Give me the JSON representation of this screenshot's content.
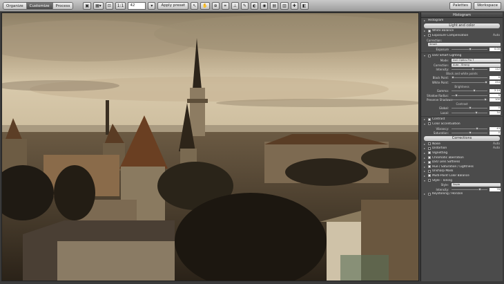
{
  "toolbar": {
    "modes": [
      "Organize",
      "Customize",
      "Process"
    ],
    "active_mode": "Customize",
    "zoom_ratio": "1:1",
    "zoom_value": "42",
    "apply_preset": "Apply preset",
    "palettes": "Palettes",
    "workspace": "Workspace"
  },
  "panel": {
    "title": "Histogram",
    "histogram_label": "Histogram",
    "light_color": "Light and color",
    "white_balance": "White Balance",
    "exposure_comp": "Exposure Compensation",
    "auto": "Auto",
    "correction_label": "Correction:",
    "correction_value": "Smart",
    "exposure_label": "Exposure",
    "exposure_value": "0.00",
    "smart_lighting": "DxO Smart Lighting",
    "mode_label": "Mode:",
    "mode_value": "DxO Optics Pro 7",
    "correction2_label": "Correction:",
    "correction2_value": "Auto - Strong",
    "intensity_label": "Intensity:",
    "intensity_value": "112",
    "black_white": "Black and white points",
    "black_point_label": "Black Point:",
    "black_point_value": "0",
    "white_point_label": "White Point:",
    "white_point_value": "254",
    "brightness": "Brightness",
    "gamma_label": "Gamma:",
    "gamma_value": "2.14",
    "shadow_radius_label": "Shadow Radius:",
    "shadow_radius_value": "9",
    "preserve_shadows_label": "Preserve Shadows:",
    "preserve_shadows_value": "100",
    "contrast": "Contrast",
    "global_label": "Global:",
    "global_value": "0",
    "local_label": "Local:",
    "local_value": "34",
    "contrast_row": "Contrast",
    "color_accent": "Color accentuation",
    "vibrancy_label": "Vibrancy:",
    "vibrancy_value": "43",
    "saturation_label": "Saturation:",
    "saturation_value": "0",
    "corrections": "Corrections",
    "noise": "Noise",
    "distortion": "Distortion",
    "vignetting": "Vignetting",
    "chromatic": "Chromatic aberration",
    "lens_softness": "DxO Lens Softness",
    "hue_sat": "Hue / Saturation / Lightness",
    "unsharp": "Unsharp Mask",
    "multipoint": "Multi-Point Color Balance",
    "style_toning": "Style - Toning",
    "style_label": "Style:",
    "style_value": "Sepia",
    "intensity2_label": "Intensity:",
    "intensity2_value": "78",
    "keystoning": "Keystoning / Horizon"
  }
}
